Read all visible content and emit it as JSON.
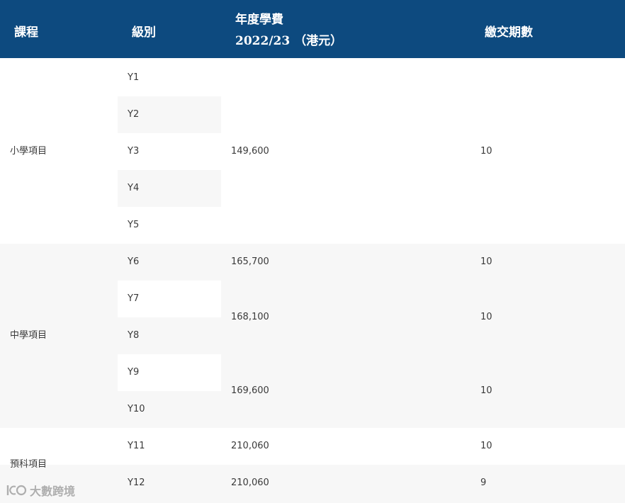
{
  "header": {
    "course": "課程",
    "level": "級別",
    "fee_line1": "年度學費",
    "fee_line2": "2022/23 （港元）",
    "installments": "繳交期數"
  },
  "programs": {
    "primary": "小學項目",
    "secondary": "中學項目",
    "preu": "預科項目"
  },
  "levels": [
    "Y1",
    "Y2",
    "Y3",
    "Y4",
    "Y5",
    "Y6",
    "Y7",
    "Y8",
    "Y9",
    "Y10",
    "Y11",
    "Y12"
  ],
  "fees": {
    "primary": "149,600",
    "y6": "165,700",
    "y7_y8": "168,100",
    "y9_y10": "169,600",
    "y11": "210,060",
    "y12": "210,060"
  },
  "installments": {
    "primary": "10",
    "y6": "10",
    "y7_y8": "10",
    "y9_y10": "10",
    "y11": "10",
    "y12": "9"
  },
  "watermark": {
    "text": "大數跨境",
    "icon": "brand-logo-icon"
  }
}
